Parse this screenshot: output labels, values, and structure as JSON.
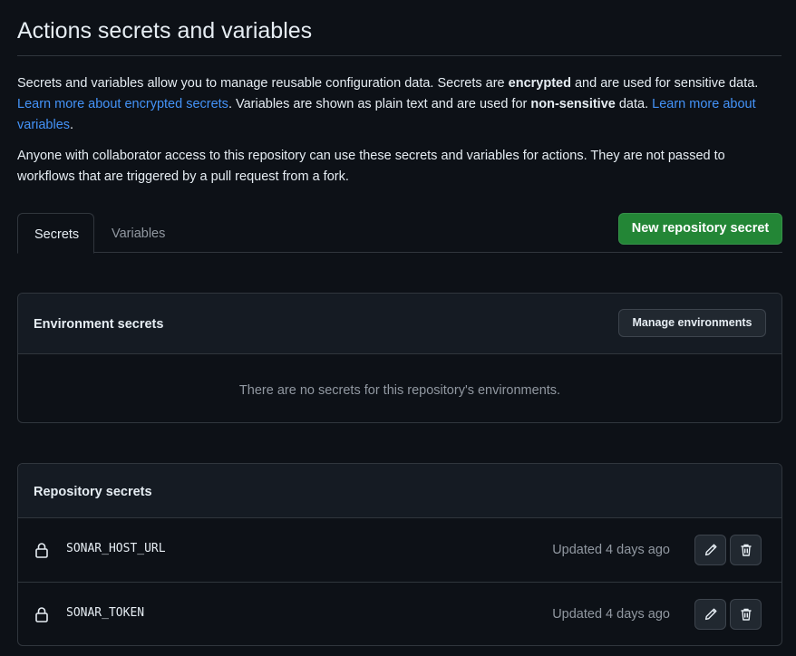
{
  "page": {
    "title": "Actions secrets and variables"
  },
  "intro": {
    "p1_a": "Secrets and variables allow you to manage reusable configuration data. Secrets are ",
    "p1_b": "encrypted",
    "p1_c": " and are used for sensitive data. ",
    "p1_link1": "Learn more about encrypted secrets",
    "p1_d": ". Variables are shown as plain text and are used for ",
    "p1_e": "non-sensitive",
    "p1_f": " data. ",
    "p1_link2": "Learn more about variables",
    "p1_g": ".",
    "p2": "Anyone with collaborator access to this repository can use these secrets and variables for actions. They are not passed to workflows that are triggered by a pull request from a fork."
  },
  "tabs": {
    "secrets": "Secrets",
    "variables": "Variables",
    "active": "Secrets"
  },
  "actions": {
    "new_secret": "New repository secret"
  },
  "environment_secrets": {
    "title": "Environment secrets",
    "manage_button": "Manage environments",
    "empty_message": "There are no secrets for this repository's environments."
  },
  "repository_secrets": {
    "title": "Repository secrets",
    "items": [
      {
        "name": "SONAR_HOST_URL",
        "updated": "Updated 4 days ago",
        "icon": "lock-icon"
      },
      {
        "name": "SONAR_TOKEN",
        "updated": "Updated 4 days ago",
        "icon": "lock-icon"
      }
    ]
  },
  "colors": {
    "background": "#0d1117",
    "link": "#4493f8",
    "primary_button": "#238636",
    "border": "#30363d",
    "muted_text": "#9198a1"
  }
}
